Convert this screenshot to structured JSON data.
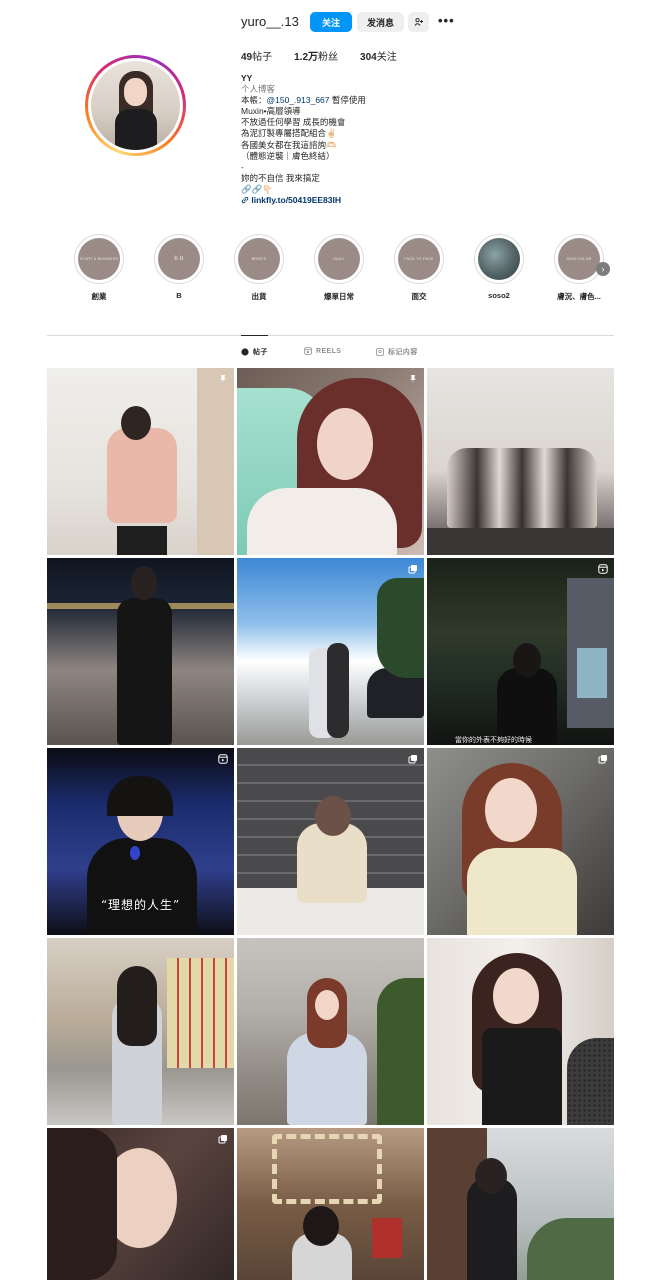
{
  "profile": {
    "username": "yuro__.13",
    "follow_label": "关注",
    "message_label": "发消息",
    "suggest_label": "+A",
    "more_label": "•••",
    "stats": {
      "posts_count": "49",
      "posts_label": "帖子",
      "followers_count": "1.2万",
      "followers_label": "粉丝",
      "following_count": "304",
      "following_label": "关注"
    },
    "bio": {
      "name": "YY",
      "category": "个人博客",
      "line1_prefix": "本帳：",
      "line1_mention": "@150_.913_667",
      "line1_suffix": " 暫停使用",
      "line2": "Muxin•高層領導",
      "line3": "不放過任何學習 成長的機會",
      "line4": "為泥訂製專屬搭配組合✌🏻",
      "line5": "各國美女都在我這諮詢🫶🏻",
      "line6": "（體態逆襲｜膚色終結）",
      "line7": "-",
      "line8": "妳的不自信 我來搞定",
      "line9": "🔗🔗👇🏻",
      "link": "linkfly.to/50419EE83lH"
    }
  },
  "highlights": [
    {
      "label": "創業",
      "cover_text": "START A BUSINESS"
    },
    {
      "label": "B",
      "cover_text": "b b"
    },
    {
      "label": "出貨",
      "cover_text": "BRIEFS"
    },
    {
      "label": "爆單日常",
      "cover_text": "DAILY"
    },
    {
      "label": "面交",
      "cover_text": "FACE TO FACE"
    },
    {
      "label": "soso2",
      "cover_text": ""
    },
    {
      "label": "膚況、膚色...",
      "cover_text": "SKIN COLOR"
    }
  ],
  "tabs": [
    {
      "label": "帖子",
      "icon": "grid-icon",
      "active": true
    },
    {
      "label": "REELS",
      "icon": "reels-icon",
      "active": false
    },
    {
      "label": "标记内容",
      "icon": "tagged-icon",
      "active": false
    }
  ],
  "posts": [
    {
      "badge": "pin-icon",
      "alt": "post-1"
    },
    {
      "badge": "pin-icon",
      "alt": "post-2"
    },
    {
      "badge": "",
      "alt": "post-3"
    },
    {
      "badge": "",
      "alt": "post-4"
    },
    {
      "badge": "carousel-icon",
      "alt": "post-5"
    },
    {
      "badge": "reel-icon",
      "alt": "post-6",
      "caption": "當你的外表不夠好的時候"
    },
    {
      "badge": "reel-icon",
      "alt": "post-7",
      "subtitle": "“理想的人生”"
    },
    {
      "badge": "carousel-icon",
      "alt": "post-8"
    },
    {
      "badge": "carousel-icon",
      "alt": "post-9"
    },
    {
      "badge": "",
      "alt": "post-10"
    },
    {
      "badge": "",
      "alt": "post-11"
    },
    {
      "badge": "",
      "alt": "post-12"
    },
    {
      "badge": "carousel-icon",
      "alt": "post-13"
    },
    {
      "badge": "",
      "alt": "post-14"
    },
    {
      "badge": "",
      "alt": "post-15"
    }
  ],
  "colors": {
    "accent": "#0095f6",
    "link": "#00376b",
    "muted": "#737373",
    "highlight_cover": "#9a8b86"
  }
}
